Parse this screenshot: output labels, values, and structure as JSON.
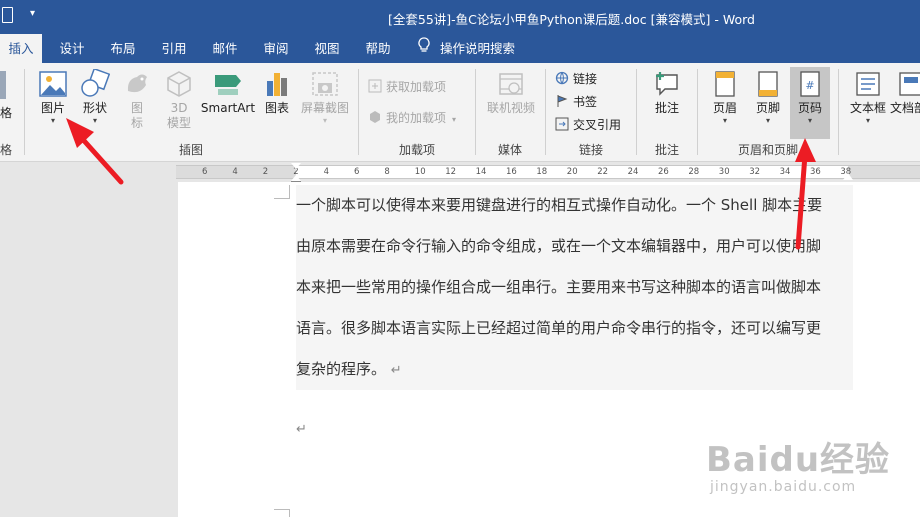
{
  "window": {
    "title": "[全套55讲]-鱼C论坛小甲鱼Python课后题.doc [兼容模式]  -  Word"
  },
  "tabs": [
    {
      "label": "插入",
      "active": true
    },
    {
      "label": "设计"
    },
    {
      "label": "布局"
    },
    {
      "label": "引用"
    },
    {
      "label": "邮件"
    },
    {
      "label": "审阅"
    },
    {
      "label": "视图"
    },
    {
      "label": "帮助"
    }
  ],
  "tell_me": "操作说明搜索",
  "ribbon": {
    "left_cut_labels": [
      "格",
      "格"
    ],
    "illustrations": {
      "picture": "图片",
      "shapes": "形状",
      "icons": "图\n标",
      "icons_l1": "图",
      "icons_l2": "标",
      "model3d_l1": "3D",
      "model3d_l2": "模型",
      "smartart": "SmartArt",
      "chart": "图表",
      "screenshot": "屏幕截图",
      "group": "插图"
    },
    "addins": {
      "get": "获取加载项",
      "mine": "我的加载项",
      "group": "加载项"
    },
    "media": {
      "online_video": "联机视频",
      "group": "媒体"
    },
    "links": {
      "link": "链接",
      "bookmark": "书签",
      "cross_ref": "交叉引用",
      "group": "链接"
    },
    "comments": {
      "comment": "批注",
      "group": "批注"
    },
    "header_footer": {
      "header": "页眉",
      "footer": "页脚",
      "page_number": "页码",
      "group": "页眉和页脚"
    },
    "text": {
      "textbox": "文本框",
      "docparts": "文档部"
    }
  },
  "ruler": {
    "numbers": [
      "6",
      "4",
      "2",
      "2",
      "4",
      "6",
      "8",
      "10",
      "12",
      "14",
      "16",
      "18",
      "20",
      "22",
      "24",
      "26",
      "28",
      "30",
      "32",
      "34",
      "36",
      "38"
    ]
  },
  "document": {
    "lines": [
      "一个脚本可以使得本来要用键盘进行的相互式操作自动化。一个 Shell 脚本主要",
      "由原本需要在命令行输入的命令组成，或在一个文本编辑器中，用户可以使用脚",
      "本来把一些常用的操作组合成一组串行。主要用来书写这种脚本的语言叫做脚本",
      "语言。很多脚本语言实际上已经超过简单的用户命令串行的指令，还可以编写更",
      "复杂的程序。"
    ],
    "pilcrow": "↵"
  },
  "watermark": {
    "logo": "Baidu经验",
    "url": "jingyan.baidu.com"
  },
  "colors": {
    "titlebar": "#2b579a",
    "ribbon": "#f3f3f3",
    "arrow": "#ec1c24"
  }
}
